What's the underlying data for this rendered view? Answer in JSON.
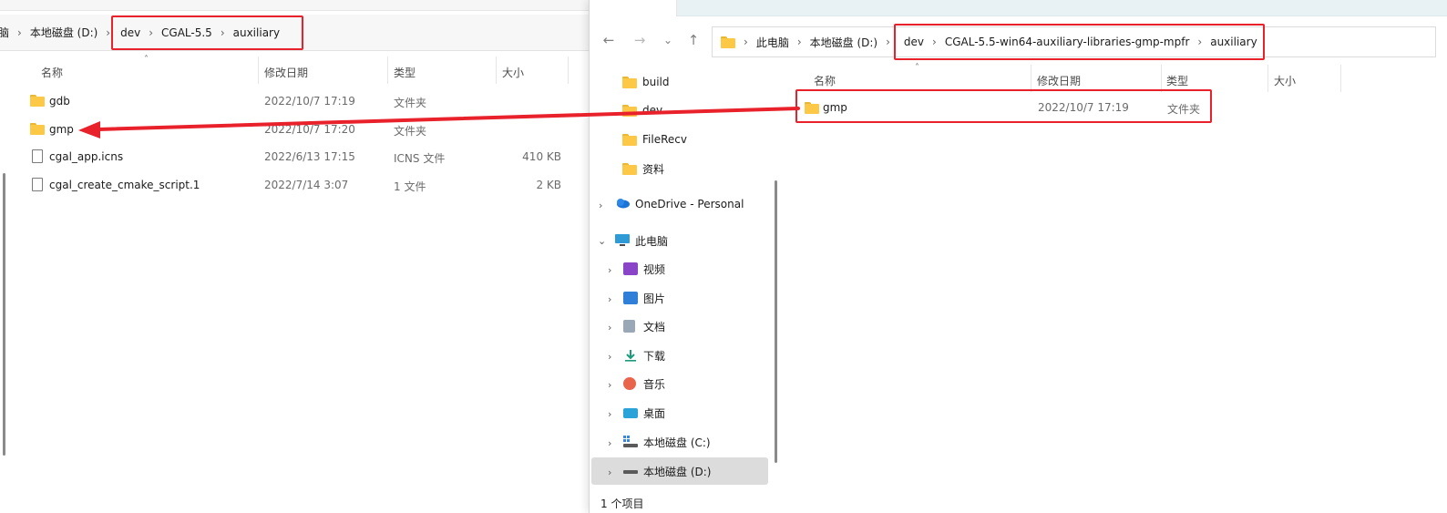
{
  "colors": {
    "highlight": "#e8212a",
    "folder": "#fcc845",
    "selected_bg": "#dcdcdc"
  },
  "left": {
    "breadcrumb_pre": [
      "脑",
      "本地磁盘 (D:)"
    ],
    "breadcrumb_highlight": [
      "dev",
      "CGAL-5.5",
      "auxiliary"
    ],
    "columns": {
      "name": "名称",
      "date": "修改日期",
      "type": "类型",
      "size": "大小"
    },
    "rows": [
      {
        "name": "gdb",
        "date": "2022/10/7 17:19",
        "type": "文件夹",
        "size": "",
        "icon": "folder-icon"
      },
      {
        "name": "gmp",
        "date": "2022/10/7 17:20",
        "type": "文件夹",
        "size": "",
        "icon": "folder-icon"
      },
      {
        "name": "cgal_app.icns",
        "date": "2022/6/13 17:15",
        "type": "ICNS 文件",
        "size": "410 KB",
        "icon": "file-icon"
      },
      {
        "name": "cgal_create_cmake_script.1",
        "date": "2022/7/14 3:07",
        "type": "1 文件",
        "size": "2 KB",
        "icon": "file-icon"
      }
    ]
  },
  "right": {
    "nav_glyphs": {
      "back": "←",
      "forward": "→",
      "recent": "⌄",
      "up": "↑"
    },
    "breadcrumb_pre": [
      "此电脑",
      "本地磁盘 (D:)"
    ],
    "breadcrumb_highlight": [
      "dev",
      "CGAL-5.5-win64-auxiliary-libraries-gmp-mpfr",
      "auxiliary"
    ],
    "columns": {
      "name": "名称",
      "date": "修改日期",
      "type": "类型",
      "size": "大小"
    },
    "rows": [
      {
        "name": "gmp",
        "date": "2022/10/7 17:19",
        "type": "文件夹"
      }
    ],
    "nav_items": [
      {
        "label": "build",
        "icon": "folder-icon"
      },
      {
        "label": "dev",
        "icon": "folder-icon"
      },
      {
        "label": "FileRecv",
        "icon": "folder-icon"
      },
      {
        "label": "资料",
        "icon": "folder-icon"
      },
      {
        "label": "OneDrive - Personal",
        "icon": "cloud-icon"
      },
      {
        "label": "此电脑",
        "icon": "computer-icon"
      },
      {
        "label": "视频",
        "icon": "video-icon"
      },
      {
        "label": "图片",
        "icon": "pictures-icon"
      },
      {
        "label": "文档",
        "icon": "documents-icon"
      },
      {
        "label": "下载",
        "icon": "download-icon"
      },
      {
        "label": "音乐",
        "icon": "music-icon"
      },
      {
        "label": "桌面",
        "icon": "desktop-icon"
      },
      {
        "label": "本地磁盘 (C:)",
        "icon": "drive-c-icon"
      },
      {
        "label": "本地磁盘 (D:)",
        "icon": "drive-d-icon"
      }
    ],
    "status_text": "1 个项目"
  }
}
